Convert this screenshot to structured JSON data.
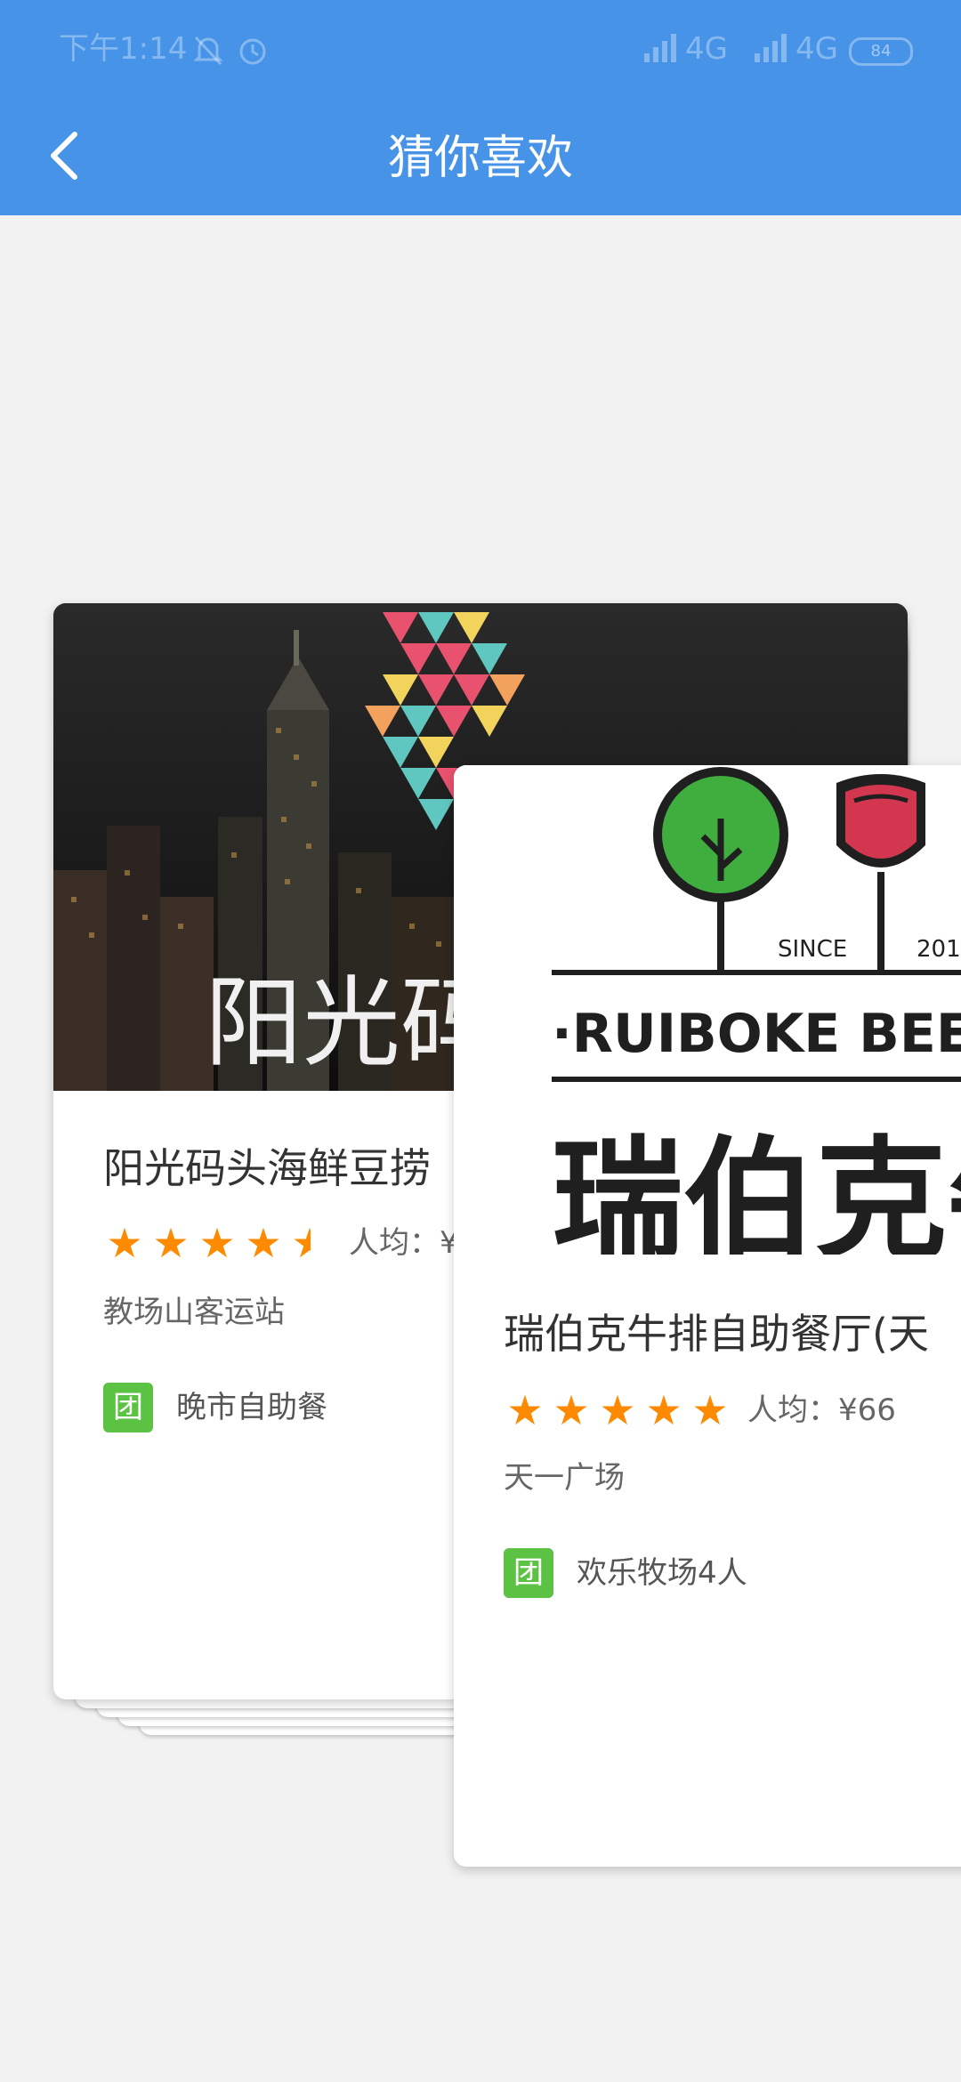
{
  "status_bar": {
    "time": "下午1:14",
    "network_1": "4G",
    "network_2": "4G",
    "battery": "84"
  },
  "header": {
    "title": "猜你喜欢",
    "background": "#4693e8"
  },
  "cards": [
    {
      "logo_text": "阳光码",
      "title": "阳光码头海鲜豆捞",
      "rating": 4.5,
      "avg_price": "人均：¥",
      "location": "教场山客运站",
      "deal_badge": "团",
      "deal": "晚市自助餐"
    },
    {
      "since": "SINCE",
      "year": "201",
      "brand_en": "·RUIBOKE BEE",
      "brand_cn": "瑞伯克牛",
      "title": "瑞伯克牛排自助餐厅(天",
      "rating": 5,
      "avg_price": "人均：¥66",
      "location": "天一广场",
      "deal_badge": "团",
      "deal": "欢乐牧场4人"
    }
  ],
  "colors": {
    "star": "#ff8a00",
    "deal_badge": "#5bc243",
    "page_bg": "#f2f2f2"
  }
}
